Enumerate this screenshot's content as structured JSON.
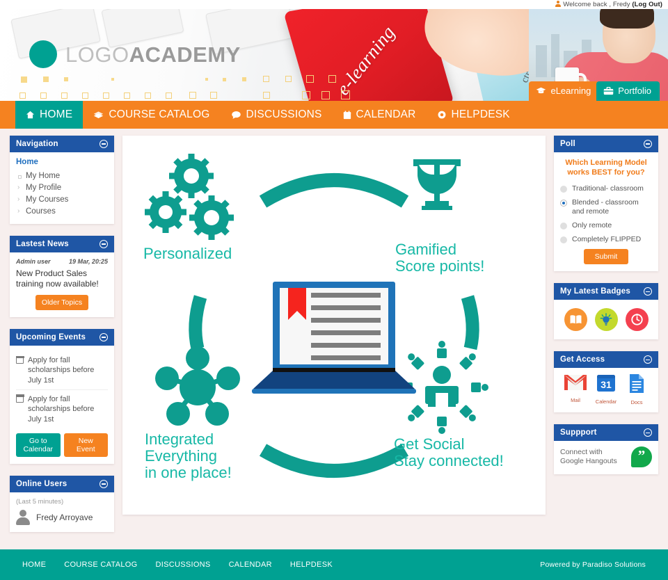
{
  "topbar": {
    "welcome_prefix": "Welcome back , Fredy ",
    "logout_label": "(Log Out)",
    "user_icon": "user-icon"
  },
  "brand": {
    "logo_light": "LOGO",
    "logo_bold": "ACADEMY",
    "banner_word": "e-learning",
    "banner_ctrl_key": "ctrl"
  },
  "banner_tabs": [
    {
      "label": "eLearning",
      "icon": "graduation-cap-icon",
      "color": "#f58220"
    },
    {
      "label": "Portfolio",
      "icon": "briefcase-icon",
      "color": "#00a192"
    }
  ],
  "nav": {
    "items": [
      {
        "label": "HOME",
        "icon": "home-icon",
        "active": true
      },
      {
        "label": "COURSE CATALOG",
        "icon": "books-icon",
        "active": false
      },
      {
        "label": "DISCUSSIONS",
        "icon": "chat-bubble-icon",
        "active": false
      },
      {
        "label": "CALENDAR",
        "icon": "calendar-icon",
        "active": false
      },
      {
        "label": "HELPDESK",
        "icon": "lifebuoy-icon",
        "active": false
      }
    ]
  },
  "left_panels": {
    "navigation": {
      "title": "Navigation",
      "home_label": "Home",
      "items": [
        {
          "label": "My Home",
          "marker": "square"
        },
        {
          "label": "My Profile",
          "marker": "chevron"
        },
        {
          "label": "My Courses",
          "marker": "chevron"
        },
        {
          "label": "Courses",
          "marker": "chevron"
        }
      ]
    },
    "news": {
      "title": "Lastest News",
      "author": "Admin user",
      "date": "19 Mar, 20:25",
      "headline": "New Product Sales training now available!",
      "button": "Older Topics"
    },
    "events": {
      "title": "Upcoming Events",
      "items": [
        {
          "text": "Apply for fall scholarships before July 1st",
          "icon": "calendar-icon"
        },
        {
          "text": "Apply for fall scholarships before July 1st",
          "icon": "calendar-icon"
        }
      ],
      "btn_calendar": "Go to Calendar",
      "btn_new": "New Event"
    },
    "online": {
      "title": "Online Users",
      "subtitle": "(Last 5 minutes)",
      "users": [
        {
          "name": "Fredy Arroyave",
          "icon": "avatar-icon"
        }
      ]
    }
  },
  "right_panels": {
    "poll": {
      "title": "Poll",
      "question": "Which Learning Model works BEST for you?",
      "options": [
        {
          "label": "Traditional- classroom",
          "selected": false
        },
        {
          "label": "Blended - classroom and remote",
          "selected": true
        },
        {
          "label": "Only remote",
          "selected": false
        },
        {
          "label": "Completely FLIPPED",
          "selected": false
        }
      ],
      "submit": "Submit"
    },
    "badges": {
      "title": "My Latest Badges",
      "items": [
        {
          "icon": "book-badge-icon",
          "color": "#f79433"
        },
        {
          "icon": "lightbulb-badge-icon",
          "color": "#c3d92d"
        },
        {
          "icon": "clock-badge-icon",
          "color": "#f4404f"
        }
      ]
    },
    "access": {
      "title": "Get Access",
      "items": [
        {
          "label": "Mail",
          "icon": "gmail-icon"
        },
        {
          "label": "Calendar",
          "icon": "google-calendar-icon",
          "day": "31"
        },
        {
          "label": "Docs",
          "icon": "google-docs-icon"
        }
      ]
    },
    "support": {
      "title": "Suppport",
      "text": "Connect with Google Hangouts",
      "icon": "hangouts-icon"
    }
  },
  "infographic": {
    "labels": [
      {
        "key": "personalized",
        "text": "Personalized",
        "icon": "gears-icon"
      },
      {
        "key": "gamified",
        "text": "Gamified\nScore points!",
        "icon": "trophy-icon"
      },
      {
        "key": "integrated",
        "text": "Integrated\nEverything\nin one place!",
        "icon": "network-nodes-icon"
      },
      {
        "key": "social",
        "text": "Get Social\nStay connected!",
        "icon": "social-people-icon"
      }
    ],
    "center_icon": "laptop-icon",
    "accent_color": "#17b8a6"
  },
  "footer": {
    "links": [
      "HOME",
      "COURSE CATALOG",
      "DISCUSSIONS",
      "CALENDAR",
      "HELPDESK"
    ],
    "credit": "Powered by Paradiso Solutions"
  }
}
